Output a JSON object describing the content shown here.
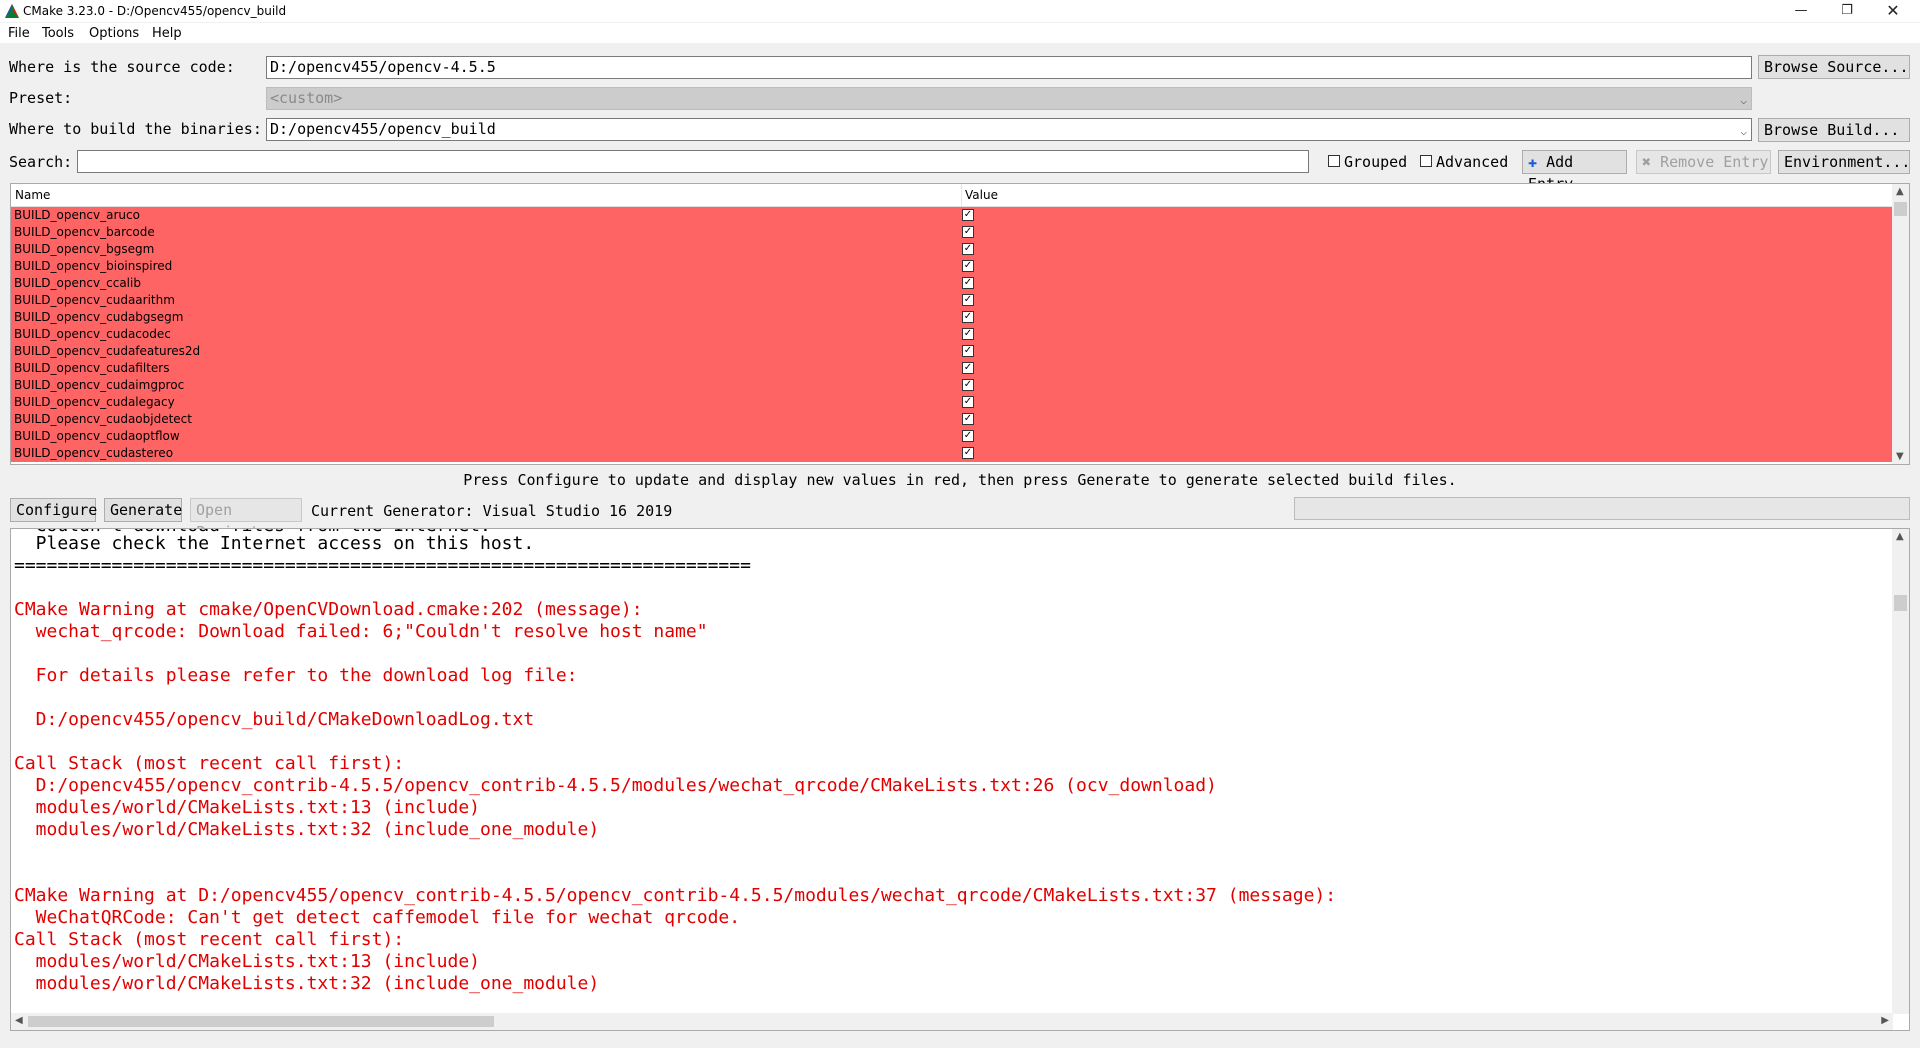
{
  "window": {
    "title": "CMake 3.23.0 - D:/Opencv455/opencv_build",
    "minimize_glyph": "—",
    "maximize_glyph": "❐",
    "close_glyph": "✕"
  },
  "menu": [
    "File",
    "Tools",
    "Options",
    "Help"
  ],
  "source": {
    "label": "Where is the source code:",
    "value": "D:/opencv455/opencv-4.5.5",
    "browse_label": "Browse Source..."
  },
  "preset": {
    "label": "Preset:",
    "value": "<custom>"
  },
  "binaries": {
    "label": "Where to build the binaries:",
    "value": "D:/opencv455/opencv_build",
    "browse_label": "Browse Build..."
  },
  "search": {
    "label": "Search:",
    "value": "",
    "grouped_label": "Grouped",
    "grouped_checked": false,
    "advanced_label": "Advanced",
    "advanced_checked": false,
    "add_entry_label": "Add Entry",
    "remove_entry_label": "Remove Entry",
    "environment_label": "Environment..."
  },
  "table": {
    "col_name": "Name",
    "col_value": "Value",
    "row_color": "#ff6464",
    "rows": [
      {
        "name": "BUILD_opencv_aruco",
        "checked": true
      },
      {
        "name": "BUILD_opencv_barcode",
        "checked": true
      },
      {
        "name": "BUILD_opencv_bgsegm",
        "checked": true
      },
      {
        "name": "BUILD_opencv_bioinspired",
        "checked": true
      },
      {
        "name": "BUILD_opencv_ccalib",
        "checked": true
      },
      {
        "name": "BUILD_opencv_cudaarithm",
        "checked": true
      },
      {
        "name": "BUILD_opencv_cudabgsegm",
        "checked": true
      },
      {
        "name": "BUILD_opencv_cudacodec",
        "checked": true
      },
      {
        "name": "BUILD_opencv_cudafeatures2d",
        "checked": true
      },
      {
        "name": "BUILD_opencv_cudafilters",
        "checked": true
      },
      {
        "name": "BUILD_opencv_cudaimgproc",
        "checked": true
      },
      {
        "name": "BUILD_opencv_cudalegacy",
        "checked": true
      },
      {
        "name": "BUILD_opencv_cudaobjdetect",
        "checked": true
      },
      {
        "name": "BUILD_opencv_cudaoptflow",
        "checked": true
      },
      {
        "name": "BUILD_opencv_cudastereo",
        "checked": true
      }
    ]
  },
  "hint": "Press Configure to update and display new values in red, then press Generate to generate selected build files.",
  "actions": {
    "configure_label": "Configure",
    "generate_label": "Generate",
    "open_project_label": "Open Project",
    "generator_text": "Current Generator: Visual Studio 16 2019"
  },
  "log_lines": [
    {
      "text": "  Please check the Internet access on this host.",
      "color": "black"
    },
    {
      "text": "====================================================================",
      "color": "black"
    },
    {
      "text": "",
      "color": "black"
    },
    {
      "text": "CMake Warning at cmake/OpenCVDownload.cmake:202 (message):",
      "color": "red"
    },
    {
      "text": "  wechat_qrcode: Download failed: 6;\"Couldn't resolve host name\"",
      "color": "red"
    },
    {
      "text": "",
      "color": "red"
    },
    {
      "text": "  For details please refer to the download log file:",
      "color": "red"
    },
    {
      "text": "",
      "color": "red"
    },
    {
      "text": "  D:/opencv455/opencv_build/CMakeDownloadLog.txt",
      "color": "red"
    },
    {
      "text": "",
      "color": "red"
    },
    {
      "text": "Call Stack (most recent call first):",
      "color": "red"
    },
    {
      "text": "  D:/opencv455/opencv_contrib-4.5.5/opencv_contrib-4.5.5/modules/wechat_qrcode/CMakeLists.txt:26 (ocv_download)",
      "color": "red"
    },
    {
      "text": "  modules/world/CMakeLists.txt:13 (include)",
      "color": "red"
    },
    {
      "text": "  modules/world/CMakeLists.txt:32 (include_one_module)",
      "color": "red"
    },
    {
      "text": "",
      "color": "red"
    },
    {
      "text": "",
      "color": "red"
    },
    {
      "text": "CMake Warning at D:/opencv455/opencv_contrib-4.5.5/opencv_contrib-4.5.5/modules/wechat_qrcode/CMakeLists.txt:37 (message):",
      "color": "red"
    },
    {
      "text": "  WeChatQRCode: Can't get detect caffemodel file for wechat qrcode.",
      "color": "red"
    },
    {
      "text": "Call Stack (most recent call first):",
      "color": "red"
    },
    {
      "text": "  modules/world/CMakeLists.txt:13 (include)",
      "color": "red"
    },
    {
      "text": "  modules/world/CMakeLists.txt:32 (include_one_module)",
      "color": "red"
    }
  ]
}
